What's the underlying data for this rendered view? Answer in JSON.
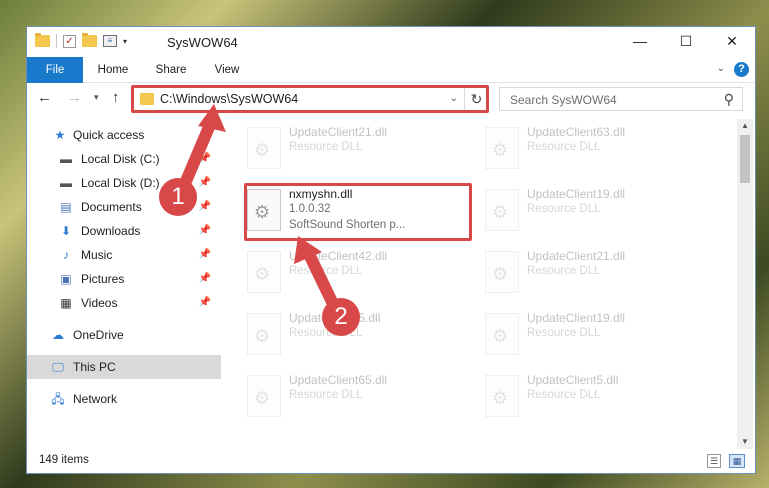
{
  "window": {
    "title": "SysWOW64",
    "controls": {
      "minimize": "—",
      "maximize": "☐",
      "close": "✕"
    }
  },
  "ribbon": {
    "tabs": [
      {
        "label": "File",
        "active": true
      },
      {
        "label": "Home"
      },
      {
        "label": "Share"
      },
      {
        "label": "View"
      }
    ],
    "help": "?"
  },
  "navigation": {
    "address": "C:\\Windows\\SysWOW64",
    "search_placeholder": "Search SysWOW64"
  },
  "sidebar": {
    "items": [
      {
        "label": "Quick access",
        "icon": "star-icon",
        "pinned": false
      },
      {
        "label": "Local Disk (C:)",
        "icon": "drive-icon",
        "pinned": true
      },
      {
        "label": "Local Disk (D:)",
        "icon": "drive-icon",
        "pinned": true
      },
      {
        "label": "Documents",
        "icon": "documents-icon",
        "pinned": true
      },
      {
        "label": "Downloads",
        "icon": "download-icon",
        "pinned": true
      },
      {
        "label": "Music",
        "icon": "music-icon",
        "pinned": true
      },
      {
        "label": "Pictures",
        "icon": "pictures-icon",
        "pinned": true
      },
      {
        "label": "Videos",
        "icon": "videos-icon",
        "pinned": true
      },
      {
        "label": "OneDrive",
        "icon": "cloud-icon",
        "pinned": false
      },
      {
        "label": "This PC",
        "icon": "computer-icon",
        "pinned": false,
        "selected": true
      },
      {
        "label": "Network",
        "icon": "network-icon",
        "pinned": false
      }
    ]
  },
  "files": [
    {
      "name": "UpdateClient21.dll",
      "line2": "Resource DLL",
      "line3": ""
    },
    {
      "name": "UpdateClient63.dll",
      "line2": "Resource DLL",
      "line3": ""
    },
    {
      "name": "nxmyshn.dll",
      "line2": "1.0.0.32",
      "line3": "SoftSound Shorten p...",
      "highlighted": true
    },
    {
      "name": "UpdateClient19.dll",
      "line2": "Resource DLL",
      "line3": ""
    },
    {
      "name": "UpdateClient42.dll",
      "line2": "Resource DLL",
      "line3": ""
    },
    {
      "name": "UpdateClient21.dll",
      "line2": "Resource DLL",
      "line3": ""
    },
    {
      "name": "UpdateClient5.dll",
      "line2": "Resource DLL",
      "line3": ""
    },
    {
      "name": "UpdateClient19.dll",
      "line2": "Resource DLL",
      "line3": ""
    },
    {
      "name": "UpdateClient65.dll",
      "line2": "Resource DLL",
      "line3": ""
    },
    {
      "name": "UpdateClient5.dll",
      "line2": "Resource DLL",
      "line3": ""
    }
  ],
  "status": {
    "item_count": "149 items"
  },
  "callouts": [
    "1",
    "2"
  ],
  "colors": {
    "accent": "#1979ca",
    "highlight": "#d94848"
  }
}
